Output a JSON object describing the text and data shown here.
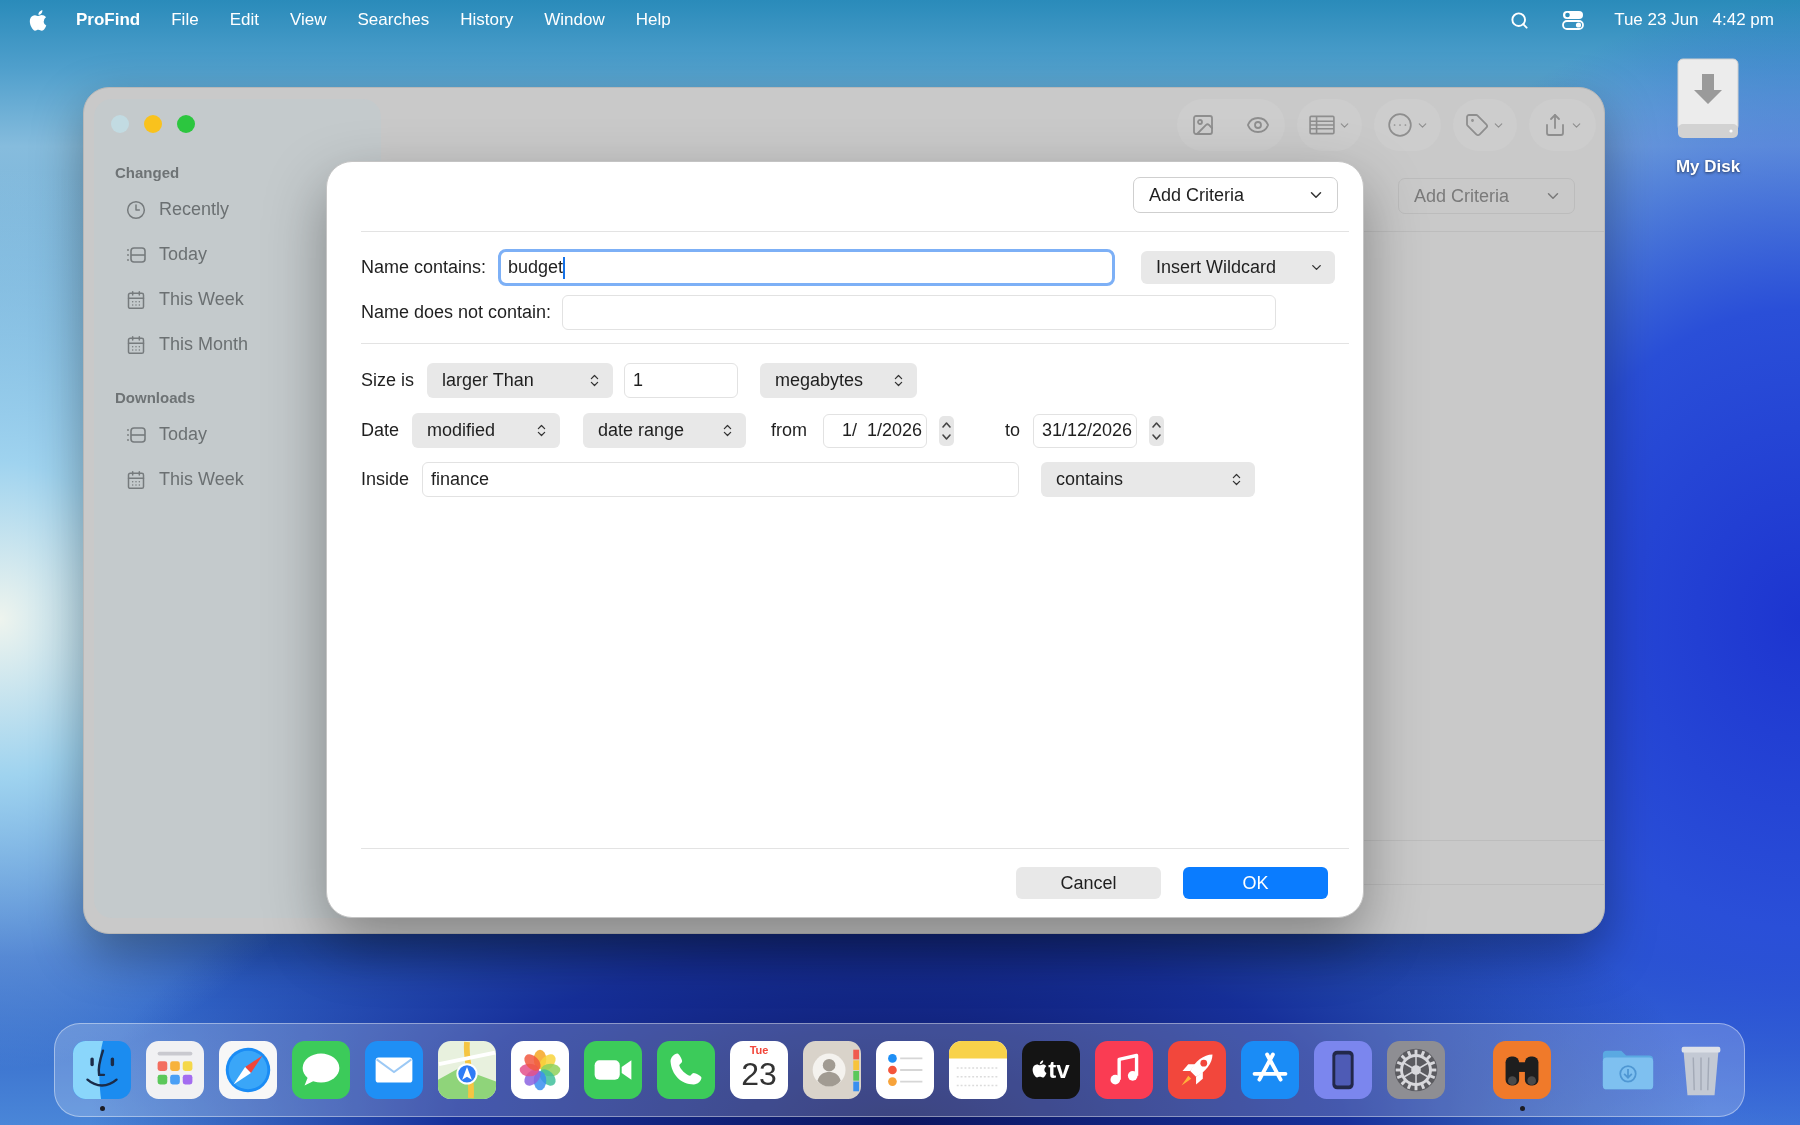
{
  "menu_bar": {
    "app_name": "ProFind",
    "menus": [
      "File",
      "Edit",
      "View",
      "Searches",
      "History",
      "Window",
      "Help"
    ],
    "date": "Tue 23 Jun",
    "time": "4:42 pm"
  },
  "desktop_icons": [
    {
      "label": "My Disk"
    }
  ],
  "window": {
    "sidebar": {
      "sections": [
        {
          "title": "Changed",
          "items": [
            {
              "label": "Recently",
              "kind": "clock",
              "selected": false
            },
            {
              "label": "Today",
              "kind": "list",
              "selected": false
            },
            {
              "label": "This Week",
              "kind": "calendar",
              "selected": false
            },
            {
              "label": "This Month",
              "kind": "calendar",
              "selected": false
            }
          ]
        },
        {
          "title": "Downloads",
          "items": [
            {
              "label": "Today",
              "kind": "list",
              "selected": false
            },
            {
              "label": "This Week",
              "kind": "calendar",
              "selected": false
            }
          ]
        }
      ]
    },
    "criteria_button": "Add Criteria"
  },
  "dialog": {
    "criteria_button": "Add Criteria",
    "name_contains": {
      "label": "Name contains:",
      "value": "budget",
      "focused": true
    },
    "wildcard_button": "Insert Wildcard",
    "name_excludes": {
      "label": "Name does not contain:"
    },
    "size": {
      "label": "Size is",
      "comparison": "larger Than",
      "value": "1",
      "unit": "megabytes"
    },
    "date": {
      "label": "Date",
      "attribute": "modified",
      "mode": "date range",
      "from_label": "from",
      "from": "1/  1/2026",
      "to_label": "to",
      "to": "31/12/2026"
    },
    "inside": {
      "label": "Inside",
      "value": "finance",
      "match": "contains"
    },
    "buttons": [
      {
        "label": "Cancel",
        "kind": "secondary"
      },
      {
        "label": "OK",
        "kind": "primary"
      }
    ]
  },
  "dock": {
    "groups": [
      {
        "items": [
          {
            "kind": "face",
            "running": true
          },
          {
            "kind": "grid",
            "running": false
          },
          {
            "kind": "compass",
            "running": false
          },
          {
            "kind": "bubble",
            "running": false
          },
          {
            "kind": "envelope",
            "running": false
          },
          {
            "kind": "map",
            "running": false
          },
          {
            "kind": "flower",
            "running": false
          },
          {
            "kind": "camera",
            "running": false
          },
          {
            "kind": "phone",
            "running": false
          },
          {
            "kind": "calendar",
            "running": false,
            "weekday": "Tue",
            "day": "23"
          },
          {
            "kind": "contact",
            "running": false
          },
          {
            "kind": "checklist",
            "running": false
          },
          {
            "kind": "notepad",
            "running": false
          },
          {
            "kind": "tv",
            "running": false,
            "label": "tv"
          },
          {
            "kind": "music",
            "running": false
          },
          {
            "kind": "rocket",
            "running": false
          },
          {
            "kind": "appstore",
            "running": false
          },
          {
            "kind": "device",
            "running": false
          },
          {
            "kind": "gear",
            "running": false
          }
        ]
      },
      {
        "items": [
          {
            "kind": "binoculars",
            "running": true
          }
        ]
      },
      {
        "items": [
          {
            "kind": "folder",
            "running": false
          },
          {
            "kind": "trash",
            "running": false
          }
        ]
      }
    ]
  }
}
